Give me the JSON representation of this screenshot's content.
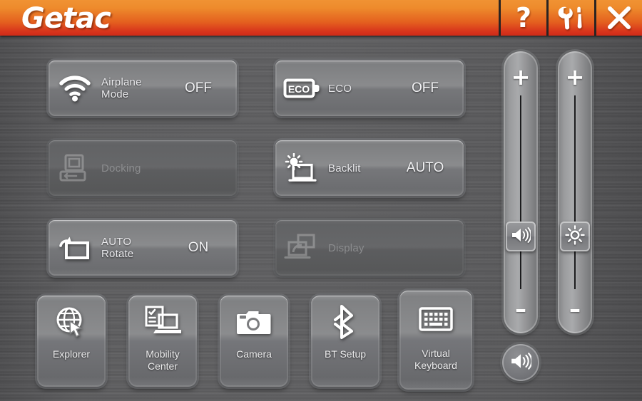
{
  "titlebar": {
    "logo": "Getac",
    "buttons": [
      {
        "name": "help-button",
        "icon": "question-mark-icon",
        "label": "?"
      },
      {
        "name": "tools-button",
        "icon": "wrench-screwdriver-icon",
        "label": "Tools"
      },
      {
        "name": "close-button",
        "icon": "close-x-icon",
        "label": "Close"
      }
    ]
  },
  "toggles": [
    {
      "id": "airplane-mode",
      "icon": "wifi-signal-icon",
      "label": "Airplane Mode",
      "value": "OFF",
      "enabled": true
    },
    {
      "id": "eco",
      "icon": "eco-battery-icon",
      "label": "ECO",
      "value": "OFF",
      "enabled": true
    },
    {
      "id": "docking",
      "icon": "docking-station-icon",
      "label": "Docking",
      "value": "",
      "enabled": false
    },
    {
      "id": "backlit",
      "icon": "sun-laptop-icon",
      "label": "Backlit",
      "value": "AUTO",
      "enabled": true
    },
    {
      "id": "auto-rotate",
      "icon": "rotate-screen-icon",
      "label": "AUTO Rotate",
      "value": "ON",
      "enabled": true
    },
    {
      "id": "display",
      "icon": "dual-display-icon",
      "label": "Display",
      "value": "",
      "enabled": false
    }
  ],
  "apps": [
    {
      "id": "explorer",
      "icon": "globe-cursor-icon",
      "label": "Explorer"
    },
    {
      "id": "mobility-center",
      "icon": "checklist-laptop-icon",
      "label": "Mobility\nCenter"
    },
    {
      "id": "camera",
      "icon": "camera-icon",
      "label": "Camera"
    },
    {
      "id": "bt-setup",
      "icon": "bluetooth-icon",
      "label": "BT Setup"
    },
    {
      "id": "virtual-keyboard",
      "icon": "keyboard-icon",
      "label": "Virtual\nKeyboard"
    }
  ],
  "sliders": [
    {
      "id": "volume-slider",
      "icon": "speaker-icon",
      "plus": "+",
      "minus": "–",
      "value_pct": 23
    },
    {
      "id": "brightness-slider",
      "icon": "brightness-icon",
      "plus": "+",
      "minus": "–",
      "value_pct": 23
    }
  ],
  "mute_button": {
    "id": "mute-button",
    "icon": "speaker-icon"
  },
  "colors": {
    "accent_top": "#f09233",
    "accent_bottom": "#cf2b18",
    "background": "#58585a",
    "button_face": "#7e7f81",
    "text": "#ececed",
    "text_disabled": "#8b8c8e"
  }
}
